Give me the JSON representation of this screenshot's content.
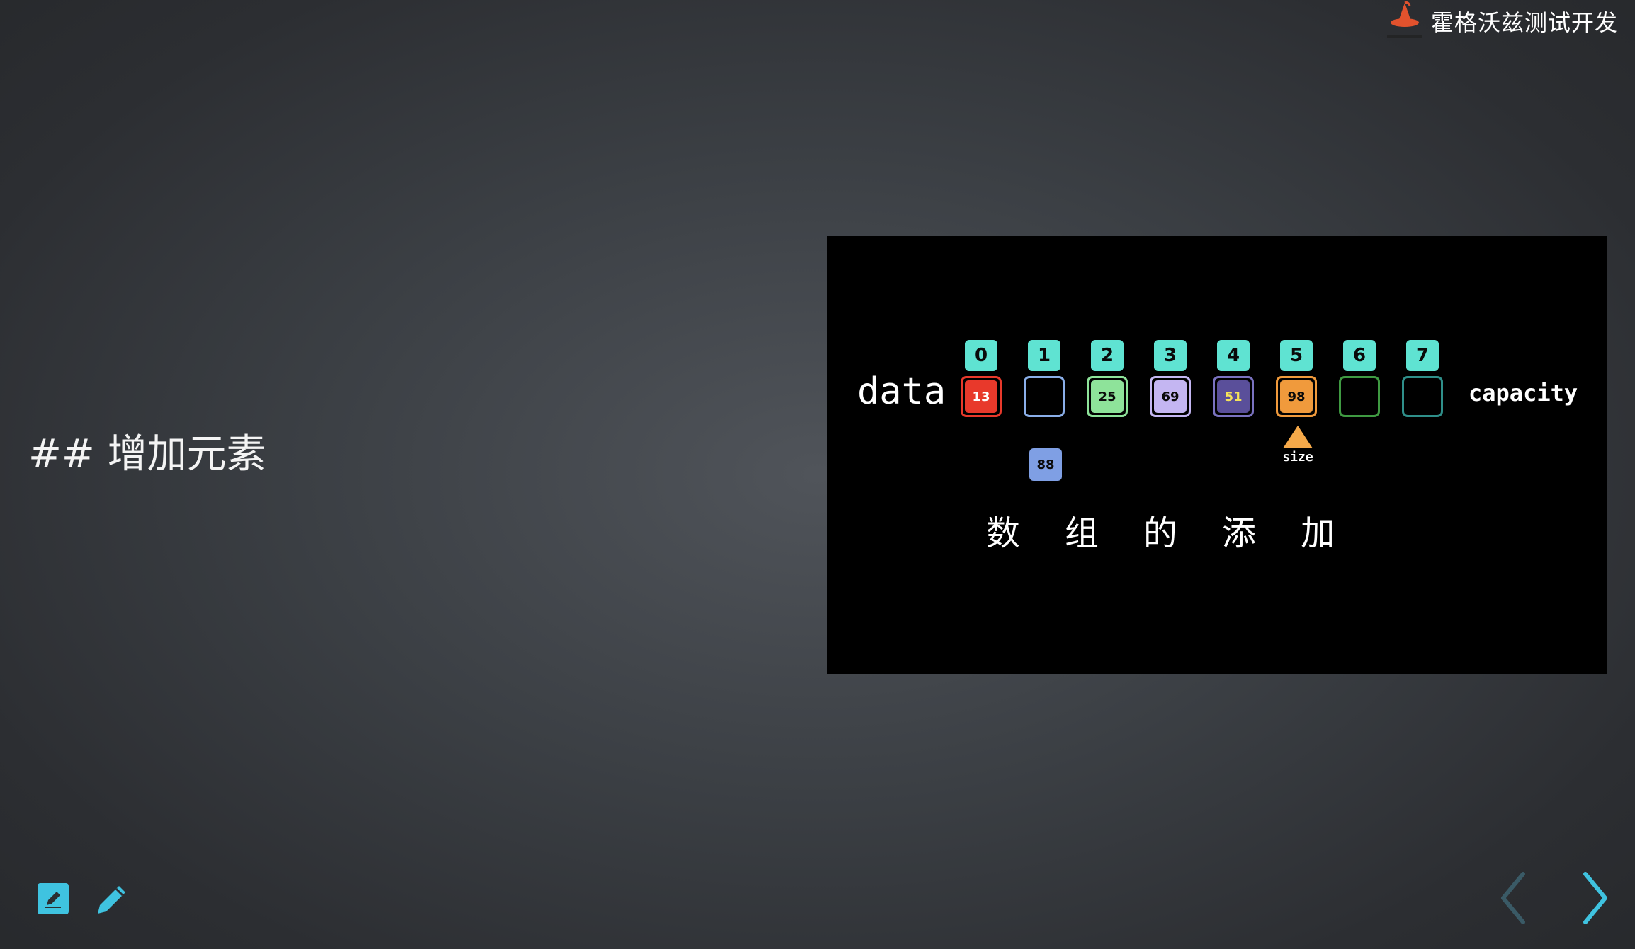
{
  "brand": {
    "name": "霍格沃兹测试开发"
  },
  "slide": {
    "heading": "## 增加元素"
  },
  "animation": {
    "data_label": "data",
    "capacity_label": "capacity",
    "indices": [
      "0",
      "1",
      "2",
      "3",
      "4",
      "5",
      "6",
      "7"
    ],
    "cells": [
      {
        "value": "13",
        "border": "#e8392b",
        "fill": "#e8392b",
        "text": "#ffffff"
      },
      {
        "value": "",
        "border": "#8aaee8",
        "fill": "",
        "text": ""
      },
      {
        "value": "25",
        "border": "#8ee39a",
        "fill": "#8ee39a",
        "text": "#0b0b0b"
      },
      {
        "value": "69",
        "border": "#c4b6f2",
        "fill": "#c4b6f2",
        "text": "#0b0b0b"
      },
      {
        "value": "51",
        "border": "#7a72c0",
        "fill": "#5a4f9a",
        "text": "#f5e35a"
      },
      {
        "value": "98",
        "border": "#f09a3c",
        "fill": "#f09a3c",
        "text": "#0b0b0b"
      },
      {
        "value": "",
        "border": "#3f9a42",
        "fill": "",
        "text": ""
      },
      {
        "value": "",
        "border": "#2f8f8a",
        "fill": "",
        "text": ""
      }
    ],
    "pending_element": "88",
    "size_pointer_label": "size",
    "size_pointer_index": 5,
    "caption": [
      "数",
      "组",
      "的",
      "添",
      "加"
    ]
  },
  "colors": {
    "index_badge": "#5fe3d2",
    "pending_element": "#7f9fe4",
    "size_arrow": "#f5a94a",
    "tool_icons": "#3fc3e0",
    "nav_prev": "#3a5a66",
    "nav_next": "#3fc3e0"
  },
  "icons": {
    "edit_square": "edit-square-icon",
    "pencil": "pencil-icon",
    "prev": "chevron-left-icon",
    "next": "chevron-right-icon",
    "logo": "wizard-hat-logo"
  }
}
